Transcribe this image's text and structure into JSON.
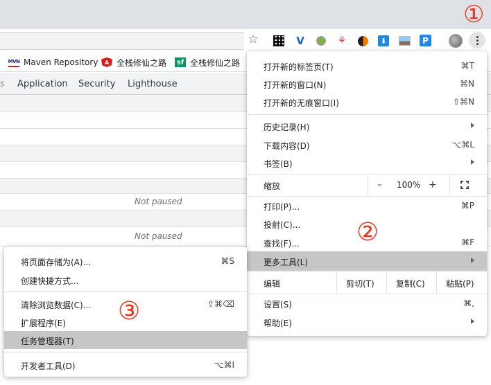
{
  "annotations": {
    "one": "①",
    "two": "②",
    "three": "③"
  },
  "toolbar": {
    "star_icon": "☆",
    "ext_v": "V",
    "ext_tree": "⚘",
    "ext_dl": "⬇",
    "ext_p": "P"
  },
  "bookmarks": [
    {
      "icon": "MVN",
      "label": "Maven Repository"
    },
    {
      "icon": "A",
      "label": "全栈修仙之路"
    },
    {
      "icon": "sf",
      "label": "全栈修仙之路"
    }
  ],
  "devtools": {
    "partial_tab": "s",
    "tabs": [
      "Application",
      "Security",
      "Lighthouse"
    ],
    "not_paused_1": "Not paused",
    "not_paused_2": "Not paused"
  },
  "menu": {
    "new_tab": {
      "label": "打开新的标签页(T)",
      "shortcut": "⌘T"
    },
    "new_window": {
      "label": "打开新的窗口(N)",
      "shortcut": "⌘N"
    },
    "new_incognito": {
      "label": "打开新的无痕窗口(I)",
      "shortcut": "⇧⌘N"
    },
    "history": {
      "label": "历史记录(H)"
    },
    "downloads": {
      "label": "下载内容(D)",
      "shortcut": "⌥⌘L"
    },
    "bookmarks": {
      "label": "书签(B)"
    },
    "zoom": {
      "label": "缩放",
      "minus": "–",
      "value": "100%",
      "plus": "+"
    },
    "print": {
      "label": "打印(P)...",
      "shortcut": "⌘P"
    },
    "cast": {
      "label": "投射(C)..."
    },
    "find": {
      "label": "查找(F)...",
      "shortcut": "⌘F"
    },
    "more_tools": {
      "label": "更多工具(L)"
    },
    "edit": {
      "label": "编辑",
      "cut": "剪切(T)",
      "copy": "复制(C)",
      "paste": "粘贴(P)"
    },
    "settings": {
      "label": "设置(S)",
      "shortcut": "⌘,"
    },
    "help": {
      "label": "帮助(E)"
    }
  },
  "submenu": {
    "save_page": {
      "label": "将页面存储为(A)...",
      "shortcut": "⌘S"
    },
    "create_shortcut": {
      "label": "创建快捷方式..."
    },
    "clear_data": {
      "label": "清除浏览数据(C)...",
      "shortcut": "⇧⌘⌫"
    },
    "extensions": {
      "label": "扩展程序(E)"
    },
    "task_manager": {
      "label": "任务管理器(T)"
    },
    "dev_tools": {
      "label": "开发者工具(D)",
      "shortcut": "⌥⌘I"
    }
  }
}
